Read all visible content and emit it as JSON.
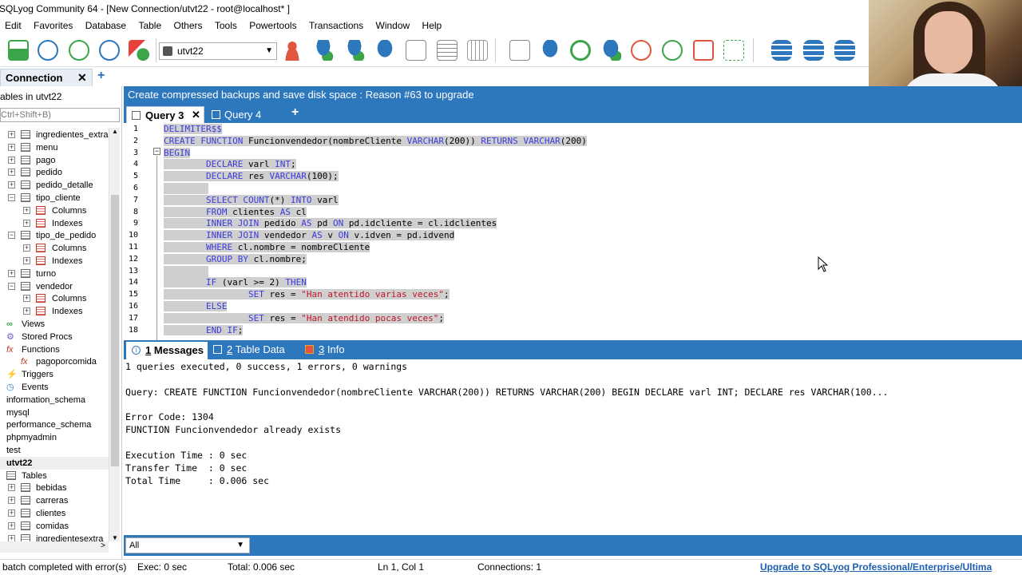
{
  "window": {
    "title": "SQLyog Community 64 - [New Connection/utvt22 - root@localhost* ]"
  },
  "menu": [
    "Edit",
    "Favorites",
    "Database",
    "Table",
    "Others",
    "Tools",
    "Powertools",
    "Transactions",
    "Window",
    "Help"
  ],
  "toolbar": {
    "database_selected": "utvt22",
    "icons": [
      "new-connection-icon",
      "execute-query-icon",
      "execute-all-icon",
      "execute-step-icon",
      "shapes-icon",
      "user-manager-icon",
      "db-sync-icon",
      "db-add-icon",
      "db-refresh-icon",
      "schema-designer-icon",
      "table-grid-icon",
      "table-data-icon",
      "checklist-icon",
      "db-copy-icon",
      "refresh-icon",
      "db-import-icon",
      "scheduler-icon",
      "next-icon",
      "window-icon",
      "layout-icon",
      "db-stack-icon",
      "db-export-icon",
      "db-backup-icon"
    ]
  },
  "connection_tab": {
    "label": "Connection",
    "close": "✕",
    "add": "+"
  },
  "object_browser": {
    "header": "ables in utvt22",
    "filter_placeholder": "Ctrl+Shift+B)",
    "items": [
      {
        "label": "ingredientes_extras",
        "type": "table",
        "level": 1,
        "exp": "+"
      },
      {
        "label": "menu",
        "type": "table",
        "level": 1,
        "exp": "+"
      },
      {
        "label": "pago",
        "type": "table",
        "level": 1,
        "exp": "+"
      },
      {
        "label": "pedido",
        "type": "table",
        "level": 1,
        "exp": "+"
      },
      {
        "label": "pedido_detalle",
        "type": "table",
        "level": 1,
        "exp": "+"
      },
      {
        "label": "tipo_cliente",
        "type": "table",
        "level": 1,
        "exp": "−"
      },
      {
        "label": "Columns",
        "type": "cols",
        "level": 2,
        "exp": "+"
      },
      {
        "label": "Indexes",
        "type": "cols",
        "level": 2,
        "exp": "+"
      },
      {
        "label": "tipo_de_pedido",
        "type": "table",
        "level": 1,
        "exp": "−"
      },
      {
        "label": "Columns",
        "type": "cols",
        "level": 2,
        "exp": "+"
      },
      {
        "label": "Indexes",
        "type": "cols",
        "level": 2,
        "exp": "+"
      },
      {
        "label": "turno",
        "type": "table",
        "level": 1,
        "exp": "+"
      },
      {
        "label": "vendedor",
        "type": "table",
        "level": 1,
        "exp": "−"
      },
      {
        "label": "Columns",
        "type": "cols",
        "level": 2,
        "exp": "+"
      },
      {
        "label": "Indexes",
        "type": "cols",
        "level": 2,
        "exp": "+"
      },
      {
        "label": "Views",
        "type": "views",
        "level": 0,
        "exp": ""
      },
      {
        "label": "Stored Procs",
        "type": "procs",
        "level": 0,
        "exp": ""
      },
      {
        "label": "Functions",
        "type": "funcs",
        "level": 0,
        "exp": ""
      },
      {
        "label": "pagoporcomida",
        "type": "func",
        "level": 1,
        "exp": ""
      },
      {
        "label": "Triggers",
        "type": "triggers",
        "level": 0,
        "exp": ""
      },
      {
        "label": "Events",
        "type": "events",
        "level": 0,
        "exp": ""
      },
      {
        "label": "information_schema",
        "type": "db",
        "level": -1,
        "exp": ""
      },
      {
        "label": "mysql",
        "type": "db",
        "level": -1,
        "exp": ""
      },
      {
        "label": "performance_schema",
        "type": "db",
        "level": -1,
        "exp": ""
      },
      {
        "label": "phpmyadmin",
        "type": "db",
        "level": -1,
        "exp": ""
      },
      {
        "label": "test",
        "type": "db",
        "level": -1,
        "exp": ""
      },
      {
        "label": "utvt22",
        "type": "db-selected",
        "level": -1,
        "exp": ""
      },
      {
        "label": "Tables",
        "type": "tables",
        "level": 0,
        "exp": ""
      },
      {
        "label": "bebidas",
        "type": "table",
        "level": 1,
        "exp": "+"
      },
      {
        "label": "carreras",
        "type": "table",
        "level": 1,
        "exp": "+"
      },
      {
        "label": "clientes",
        "type": "table",
        "level": 1,
        "exp": "+"
      },
      {
        "label": "comidas",
        "type": "table",
        "level": 1,
        "exp": "+"
      },
      {
        "label": "ingredientesextra",
        "type": "table",
        "level": 1,
        "exp": "+"
      }
    ]
  },
  "banner": "Create compressed backups and save disk space : Reason #63 to upgrade",
  "query_tabs": [
    {
      "label": "Query 3",
      "active": true,
      "close": "✕"
    },
    {
      "label": "Query 4",
      "active": false
    }
  ],
  "query_tab_add": "+",
  "editor": {
    "lines": [
      [
        {
          "t": "DELIMITER$$",
          "c": "kw"
        }
      ],
      [
        {
          "t": "CREATE FUNCTION ",
          "c": "kw"
        },
        {
          "t": "Funcionvendedor(nombreCliente ",
          "c": ""
        },
        {
          "t": "VARCHAR",
          "c": "kw"
        },
        {
          "t": "(200)) ",
          "c": ""
        },
        {
          "t": "RETURNS VARCHAR",
          "c": "kw"
        },
        {
          "t": "(200)",
          "c": ""
        }
      ],
      [
        {
          "t": "BEGIN",
          "c": "kw"
        }
      ],
      [
        {
          "t": "        ",
          "c": ""
        },
        {
          "t": "DECLARE",
          "c": "kw"
        },
        {
          "t": " varl ",
          "c": ""
        },
        {
          "t": "INT",
          "c": "kw"
        },
        {
          "t": ";",
          "c": ""
        }
      ],
      [
        {
          "t": "        ",
          "c": ""
        },
        {
          "t": "DECLARE",
          "c": "kw"
        },
        {
          "t": " res ",
          "c": ""
        },
        {
          "t": "VARCHAR",
          "c": "kw"
        },
        {
          "t": "(100);",
          "c": ""
        }
      ],
      [
        {
          "t": "",
          "c": ""
        }
      ],
      [
        {
          "t": "        ",
          "c": ""
        },
        {
          "t": "SELECT COUNT",
          "c": "kw"
        },
        {
          "t": "(*) ",
          "c": ""
        },
        {
          "t": "INTO",
          "c": "kw"
        },
        {
          "t": " varl",
          "c": ""
        }
      ],
      [
        {
          "t": "        ",
          "c": ""
        },
        {
          "t": "FROM",
          "c": "kw"
        },
        {
          "t": " clientes ",
          "c": ""
        },
        {
          "t": "AS",
          "c": "kw"
        },
        {
          "t": " cl",
          "c": ""
        }
      ],
      [
        {
          "t": "        ",
          "c": ""
        },
        {
          "t": "INNER JOIN",
          "c": "kw"
        },
        {
          "t": " pedido ",
          "c": ""
        },
        {
          "t": "AS",
          "c": "kw"
        },
        {
          "t": " pd ",
          "c": ""
        },
        {
          "t": "ON",
          "c": "kw"
        },
        {
          "t": " pd.idcliente = cl.idclientes",
          "c": ""
        }
      ],
      [
        {
          "t": "        ",
          "c": ""
        },
        {
          "t": "INNER JOIN",
          "c": "kw"
        },
        {
          "t": " vendedor ",
          "c": ""
        },
        {
          "t": "AS",
          "c": "kw"
        },
        {
          "t": " v ",
          "c": ""
        },
        {
          "t": "ON",
          "c": "kw"
        },
        {
          "t": " v.idven = pd.idvend",
          "c": ""
        }
      ],
      [
        {
          "t": "        ",
          "c": ""
        },
        {
          "t": "WHERE",
          "c": "kw"
        },
        {
          "t": " cl.nombre = nombreCliente",
          "c": ""
        }
      ],
      [
        {
          "t": "        ",
          "c": ""
        },
        {
          "t": "GROUP BY",
          "c": "kw"
        },
        {
          "t": " cl.nombre;",
          "c": ""
        }
      ],
      [
        {
          "t": "",
          "c": ""
        }
      ],
      [
        {
          "t": "        ",
          "c": ""
        },
        {
          "t": "IF",
          "c": "kw"
        },
        {
          "t": " (varl >= 2) ",
          "c": ""
        },
        {
          "t": "THEN",
          "c": "kw"
        }
      ],
      [
        {
          "t": "                ",
          "c": ""
        },
        {
          "t": "SET",
          "c": "kw"
        },
        {
          "t": " res = ",
          "c": ""
        },
        {
          "t": "\"Han atentido varias veces\"",
          "c": "str"
        },
        {
          "t": ";",
          "c": ""
        }
      ],
      [
        {
          "t": "        ",
          "c": ""
        },
        {
          "t": "ELSE",
          "c": "kw"
        }
      ],
      [
        {
          "t": "                ",
          "c": ""
        },
        {
          "t": "SET",
          "c": "kw"
        },
        {
          "t": " res = ",
          "c": ""
        },
        {
          "t": "\"Han atendido pocas veces\"",
          "c": "str"
        },
        {
          "t": ";",
          "c": ""
        }
      ],
      [
        {
          "t": "        ",
          "c": ""
        },
        {
          "t": "END IF",
          "c": "kw"
        },
        {
          "t": ";",
          "c": ""
        }
      ]
    ]
  },
  "result_tabs": [
    {
      "num": "1",
      "label": "Messages"
    },
    {
      "num": "2",
      "label": "Table Data"
    },
    {
      "num": "3",
      "label": "Info"
    }
  ],
  "messages": {
    "summary": "1 queries executed, 0 success, 1 errors, 0 warnings",
    "query": "Query: CREATE FUNCTION Funcionvendedor(nombreCliente VARCHAR(200)) RETURNS VARCHAR(200) BEGIN DECLARE varl INT; DECLARE res VARCHAR(100...",
    "error_code": "Error Code: 1304",
    "error_msg": "FUNCTION Funcionvendedor already exists",
    "exec_time": "Execution Time : 0 sec",
    "transfer_time": "Transfer Time  : 0 sec",
    "total_time": "Total Time     : 0.006 sec"
  },
  "filter": {
    "value": "All"
  },
  "status": {
    "batch": "batch completed with error(s)",
    "exec": "Exec: 0 sec",
    "total": "Total: 0.006 sec",
    "position": "Ln 1, Col 1",
    "connections": "Connections: 1",
    "upgrade": "Upgrade to SQLyog Professional/Enterprise/Ultima"
  },
  "colors": {
    "accent": "#2d77bd",
    "keyword": "#3b3bdc",
    "string": "#c0162a",
    "link": "#1c5fb0"
  }
}
